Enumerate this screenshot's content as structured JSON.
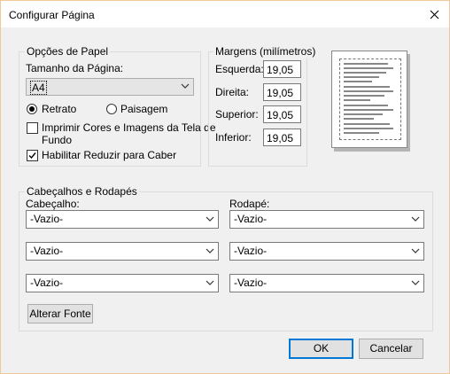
{
  "dialog": {
    "title": "Configurar Página",
    "close_icon": "close-icon"
  },
  "paper": {
    "group_label": "Opções de Papel",
    "size_label": "Tamanho da Página:",
    "size_value": "A4",
    "orientation": {
      "portrait_label": "Retrato",
      "landscape_label": "Paisagem",
      "selected": "Retrato"
    },
    "print_background_label_line1": "Imprimir Cores e Imagens da Tela de",
    "print_background_label_line2": "Fundo",
    "print_background_checked": false,
    "shrink_to_fit_label": "Habilitar Reduzir para Caber",
    "shrink_to_fit_checked": true
  },
  "margins": {
    "group_label": "Margens (milímetros)",
    "left_label": "Esquerda:",
    "left_value": "19,05",
    "right_label": "Direita:",
    "right_value": "19,05",
    "top_label": "Superior:",
    "top_value": "19,05",
    "bottom_label": "Inferior:",
    "bottom_value": "19,05"
  },
  "headers_footers": {
    "group_label": "Cabeçalhos e Rodapés",
    "header_label": "Cabeçalho:",
    "footer_label": "Rodapé:",
    "header_values": [
      "-Vazio-",
      "-Vazio-",
      "-Vazio-"
    ],
    "footer_values": [
      "-Vazio-",
      "-Vazio-",
      "-Vazio-"
    ],
    "change_font_label": "Alterar Fonte"
  },
  "buttons": {
    "ok_label": "OK",
    "cancel_label": "Cancelar"
  }
}
